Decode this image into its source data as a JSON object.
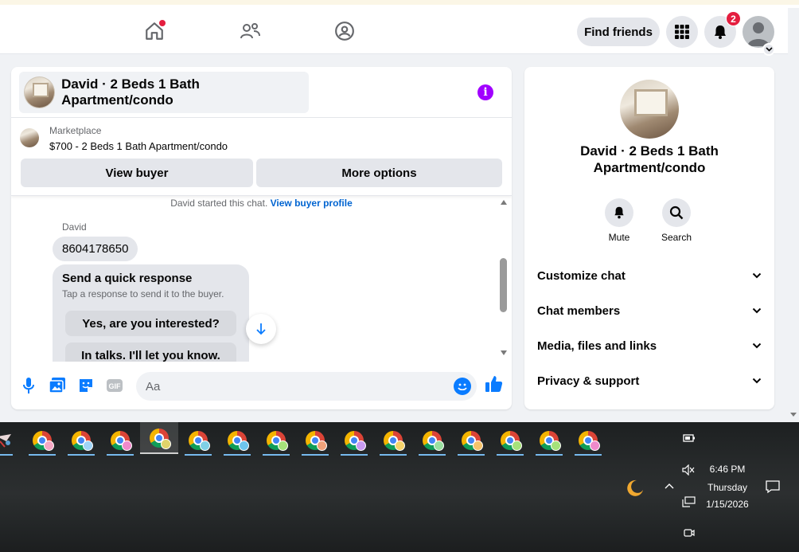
{
  "navbar": {
    "find_friends_label": "Find friends",
    "notification_count": "2"
  },
  "chat": {
    "title": "David · 2 Beds 1 Bath Apartment/condo",
    "marketplace_label": "Marketplace",
    "listing": "$700 - 2 Beds 1 Bath Apartment/condo",
    "view_buyer_label": "View buyer",
    "more_options_label": "More options",
    "started_text": "David started this chat.",
    "buyer_profile_link": "View buyer profile",
    "sender_name": "David",
    "message_text": "8604178650",
    "quick_response": {
      "title": "Send a quick response",
      "subtitle": "Tap a response to send it to the buyer.",
      "options": [
        "Yes, are you interested?",
        "In talks. I'll let you know."
      ]
    },
    "composer_placeholder": "Aa"
  },
  "side_panel": {
    "name": "David · 2 Beds 1 Bath Apartment/condo",
    "mute_label": "Mute",
    "search_label": "Search",
    "rows": [
      "Customize chat",
      "Chat members",
      "Media, files and links",
      "Privacy & support"
    ]
  },
  "taskbar": {
    "time": "6:46 PM",
    "day": "Thursday",
    "date": "1/15/2026",
    "profile_colors": [
      "#f7a8c4",
      "#9fd4f7",
      "#f08acb",
      "#e0d36b",
      "#7fd0e6",
      "#6ec6ee",
      "#a6e27a",
      "#f1a27a",
      "#c89af2",
      "#f6d36b",
      "#9ae0a0",
      "#f5c36b",
      "#a6e27a",
      "#a6e27a",
      "#f08acb"
    ],
    "active_index": 3
  },
  "colors": {
    "accent": "#0a7cff",
    "info_purple": "#a100ff",
    "link": "#0064d1",
    "badge": "#e41e3f"
  }
}
